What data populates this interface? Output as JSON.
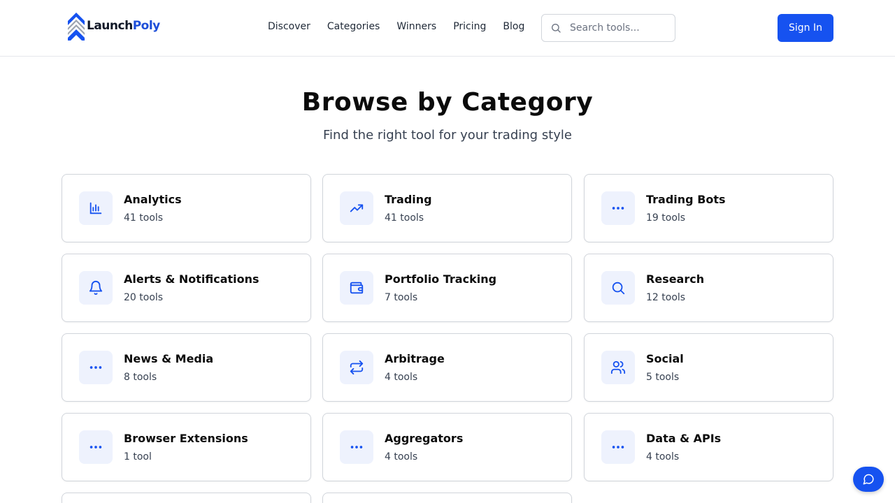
{
  "brand": {
    "name_a": "Launch",
    "name_b": "Poly",
    "brand_color": "#1652f0"
  },
  "nav": [
    {
      "label": "Discover"
    },
    {
      "label": "Categories"
    },
    {
      "label": "Winners"
    },
    {
      "label": "Pricing"
    },
    {
      "label": "Blog"
    }
  ],
  "search": {
    "placeholder": "Search tools...",
    "icon": "search-icon"
  },
  "auth": {
    "signin_label": "Sign In"
  },
  "page": {
    "title": "Browse by Category",
    "subtitle": "Find the right tool for your trading style"
  },
  "categories": [
    {
      "name": "Analytics",
      "count": "41 tools",
      "icon": "bar-chart-icon"
    },
    {
      "name": "Trading",
      "count": "41 tools",
      "icon": "trending-up-icon"
    },
    {
      "name": "Trading Bots",
      "count": "19 tools",
      "icon": "more-dots-icon"
    },
    {
      "name": "Alerts & Notifications",
      "count": "20 tools",
      "icon": "bell-icon"
    },
    {
      "name": "Portfolio Tracking",
      "count": "7 tools",
      "icon": "wallet-icon"
    },
    {
      "name": "Research",
      "count": "12 tools",
      "icon": "search-icon"
    },
    {
      "name": "News & Media",
      "count": "8 tools",
      "icon": "more-dots-icon"
    },
    {
      "name": "Arbitrage",
      "count": "4 tools",
      "icon": "arrows-repeat-icon"
    },
    {
      "name": "Social",
      "count": "5 tools",
      "icon": "users-icon"
    },
    {
      "name": "Browser Extensions",
      "count": "1 tool",
      "icon": "more-dots-icon"
    },
    {
      "name": "Aggregators",
      "count": "4 tools",
      "icon": "more-dots-icon"
    },
    {
      "name": "Data & APIs",
      "count": "4 tools",
      "icon": "more-dots-icon"
    }
  ],
  "chat": {
    "icon": "chat-bubble-icon"
  }
}
